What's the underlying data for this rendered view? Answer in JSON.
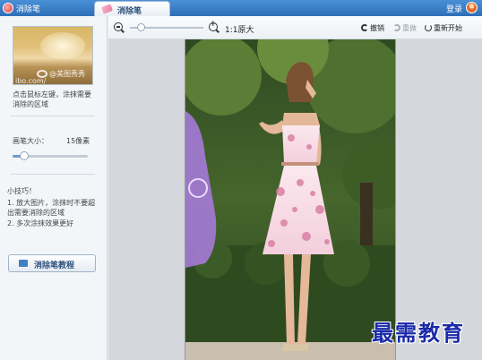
{
  "window": {
    "app_title": "消除笔",
    "login_label": "登录"
  },
  "tab": {
    "label": "消除笔"
  },
  "sidebar": {
    "thumb_watermark_1": "@美图秀秀",
    "thumb_watermark_2": "ibo.com/",
    "hint": "点击鼠标左键，涂抹需要消除的区域",
    "brush_size_label": "画笔大小：",
    "brush_size_value": "15像素",
    "brush_size_level": 0.15,
    "tips_title": "小技巧！",
    "tips": [
      "1. 放大图片，涂抹时不要超出需要消除的区域",
      "2. 多次涂抹效果更好"
    ],
    "tutorial_button": "消除笔教程"
  },
  "toolbar": {
    "zoom_level": 0.15,
    "original_size": "1:1原大",
    "undo": "撤销",
    "redo": "重做",
    "reset": "重新开始"
  },
  "overlay": {
    "watermark": "最需教育"
  }
}
